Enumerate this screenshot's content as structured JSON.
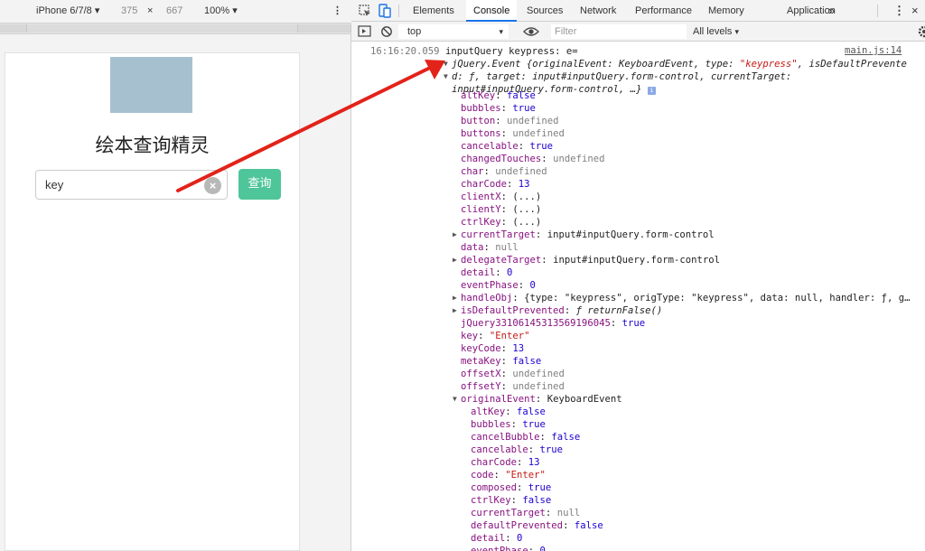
{
  "device_toolbar": {
    "device": "iPhone 6/7/8",
    "width": "375",
    "times": "×",
    "height": "667",
    "zoom": "100%"
  },
  "app": {
    "title": "绘本查询精灵",
    "input_value": "key",
    "clear_glyph": "×",
    "search_label": "查询"
  },
  "devtools": {
    "tabs": [
      "Elements",
      "Console",
      "Sources",
      "Network",
      "Performance",
      "Memory",
      "Application"
    ],
    "more": "»",
    "context": "top",
    "filter_placeholder": "Filter",
    "levels": "All levels"
  },
  "console": {
    "timestamp": "16:16:20.059",
    "message": "inputQuery keypress: e=",
    "source": "main.js:14",
    "summary_prefix": "jQuery.Event {originalEvent: KeyboardEvent, type: ",
    "summary_type": "\"keypress\"",
    "summary_suffix": ", isDefaultPrevente",
    "d_line": "d: ƒ, target: input#inputQuery.form-control, currentTarget:",
    "d_line2": "input#inputQuery.form-control, …}",
    "info_glyph": "i",
    "props": [
      {
        "k": "altKey",
        "v": "false",
        "t": "n"
      },
      {
        "k": "bubbles",
        "v": "true",
        "t": "n"
      },
      {
        "k": "button",
        "v": "undefined",
        "t": "g"
      },
      {
        "k": "buttons",
        "v": "undefined",
        "t": "g"
      },
      {
        "k": "cancelable",
        "v": "true",
        "t": "n"
      },
      {
        "k": "changedTouches",
        "v": "undefined",
        "t": "g"
      },
      {
        "k": "char",
        "v": "undefined",
        "t": "g"
      },
      {
        "k": "charCode",
        "v": "13",
        "t": "n"
      },
      {
        "k": "clientX",
        "v": "(...)",
        "t": "x"
      },
      {
        "k": "clientY",
        "v": "(...)",
        "t": "x"
      },
      {
        "k": "ctrlKey",
        "v": "(...)",
        "t": "x"
      },
      {
        "k": "currentTarget",
        "v": "input#inputQuery.form-control",
        "t": "x",
        "tri": true
      },
      {
        "k": "data",
        "v": "null",
        "t": "g"
      },
      {
        "k": "delegateTarget",
        "v": "input#inputQuery.form-control",
        "t": "x",
        "tri": true
      },
      {
        "k": "detail",
        "v": "0",
        "t": "n"
      },
      {
        "k": "eventPhase",
        "v": "0",
        "t": "n"
      },
      {
        "k": "handleObj",
        "v": "{type: \"keypress\", origType: \"keypress\", data: null, handler: ƒ, g…",
        "t": "x",
        "tri": true
      },
      {
        "k": "isDefaultPrevented",
        "v": "ƒ returnFalse()",
        "t": "it",
        "tri": true
      },
      {
        "k": "jQuery33106145313569196045",
        "v": "true",
        "t": "n"
      },
      {
        "k": "key",
        "v": "\"Enter\"",
        "t": "s"
      },
      {
        "k": "keyCode",
        "v": "13",
        "t": "n"
      },
      {
        "k": "metaKey",
        "v": "false",
        "t": "n"
      },
      {
        "k": "offsetX",
        "v": "undefined",
        "t": "g"
      },
      {
        "k": "offsetY",
        "v": "undefined",
        "t": "g"
      },
      {
        "k": "originalEvent",
        "v": "KeyboardEvent",
        "t": "x",
        "tri": true,
        "open": true
      }
    ],
    "sub_props": [
      {
        "k": "altKey",
        "v": "false",
        "t": "n"
      },
      {
        "k": "bubbles",
        "v": "true",
        "t": "n"
      },
      {
        "k": "cancelBubble",
        "v": "false",
        "t": "n"
      },
      {
        "k": "cancelable",
        "v": "true",
        "t": "n"
      },
      {
        "k": "charCode",
        "v": "13",
        "t": "n"
      },
      {
        "k": "code",
        "v": "\"Enter\"",
        "t": "s"
      },
      {
        "k": "composed",
        "v": "true",
        "t": "n"
      },
      {
        "k": "ctrlKey",
        "v": "false",
        "t": "n"
      },
      {
        "k": "currentTarget",
        "v": "null",
        "t": "g"
      },
      {
        "k": "defaultPrevented",
        "v": "false",
        "t": "n"
      },
      {
        "k": "detail",
        "v": "0",
        "t": "n"
      },
      {
        "k": "eventPhase",
        "v": "0",
        "t": "n"
      }
    ]
  }
}
